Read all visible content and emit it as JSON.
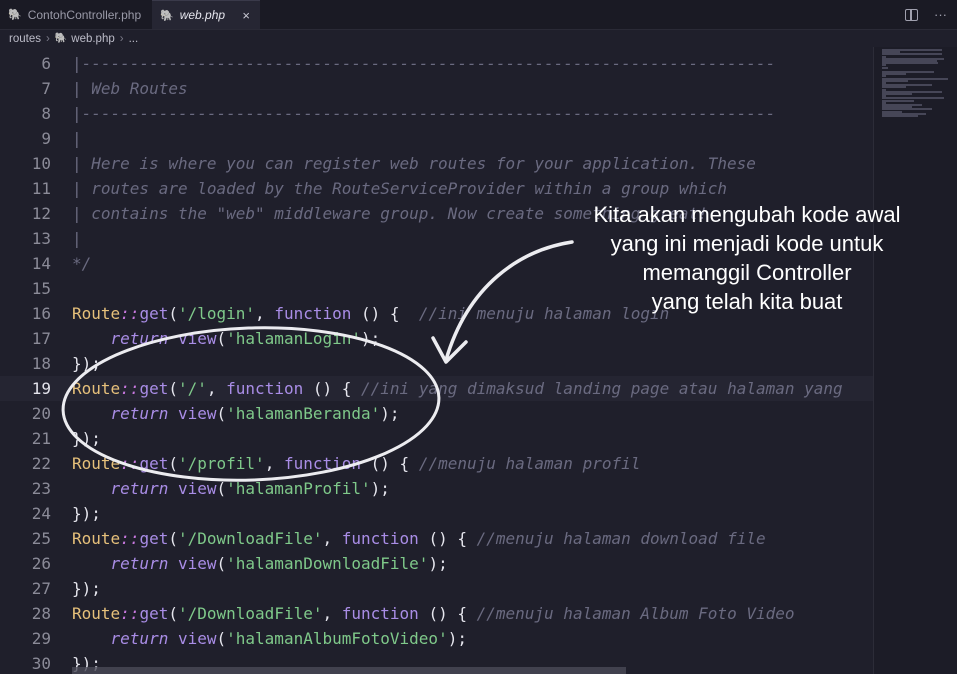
{
  "tabs": [
    {
      "label": "ContohController.php",
      "active": false
    },
    {
      "label": "web.php",
      "active": true,
      "close": "×"
    }
  ],
  "tab_actions": {
    "split_icon": "split-editor-icon",
    "more": "···"
  },
  "breadcrumb": {
    "folder": "routes",
    "file": "web.php",
    "ellipsis": "..."
  },
  "editor": {
    "current_line": 19,
    "lines": [
      {
        "n": "6",
        "code": "|------------------------------------------------------------------------"
      },
      {
        "n": "7",
        "code": "| Web Routes"
      },
      {
        "n": "8",
        "code": "|------------------------------------------------------------------------"
      },
      {
        "n": "9",
        "code": "|"
      },
      {
        "n": "10",
        "code": "| Here is where you can register web routes for your application. These"
      },
      {
        "n": "11",
        "code": "| routes are loaded by the RouteServiceProvider within a group which"
      },
      {
        "n": "12",
        "code": "| contains the \"web\" middleware group. Now create something great!"
      },
      {
        "n": "13",
        "code": "|"
      },
      {
        "n": "14",
        "code": "*/"
      },
      {
        "n": "15",
        "code": ""
      },
      {
        "n": "16",
        "code": "Route::get('/login', function () {  //ini menuju halaman login"
      },
      {
        "n": "17",
        "code": "    return view('halamanLogin');"
      },
      {
        "n": "18",
        "code": "});"
      },
      {
        "n": "19",
        "code": "Route::get('/', function () { //ini yang dimaksud landing page atau halaman yang"
      },
      {
        "n": "20",
        "code": "    return view('halamanBeranda');"
      },
      {
        "n": "21",
        "code": "});"
      },
      {
        "n": "22",
        "code": "Route::get('/profil', function () { //menuju halaman profil"
      },
      {
        "n": "23",
        "code": "    return view('halamanProfil');"
      },
      {
        "n": "24",
        "code": "});"
      },
      {
        "n": "25",
        "code": "Route::get('/DownloadFile', function () { //menuju halaman download file"
      },
      {
        "n": "26",
        "code": "    return view('halamanDownloadFile');"
      },
      {
        "n": "27",
        "code": "});"
      },
      {
        "n": "28",
        "code": "Route::get('/DownloadFile', function () { //menuju halaman Album Foto Video"
      },
      {
        "n": "29",
        "code": "    return view('halamanAlbumFotoVideo');"
      },
      {
        "n": "30",
        "code": "});"
      }
    ]
  },
  "annotation": {
    "lines": [
      "Kita akan mengubah kode awal",
      "yang ini menjadi kode untuk",
      "memanggil Controller",
      "yang telah kita buat"
    ]
  },
  "colors": {
    "background": "#1f1f2b",
    "class": "#e6c07b",
    "function": "#a98de6",
    "string": "#7fc98a",
    "comment": "#6a6a80",
    "annotation": "#ffffff"
  }
}
